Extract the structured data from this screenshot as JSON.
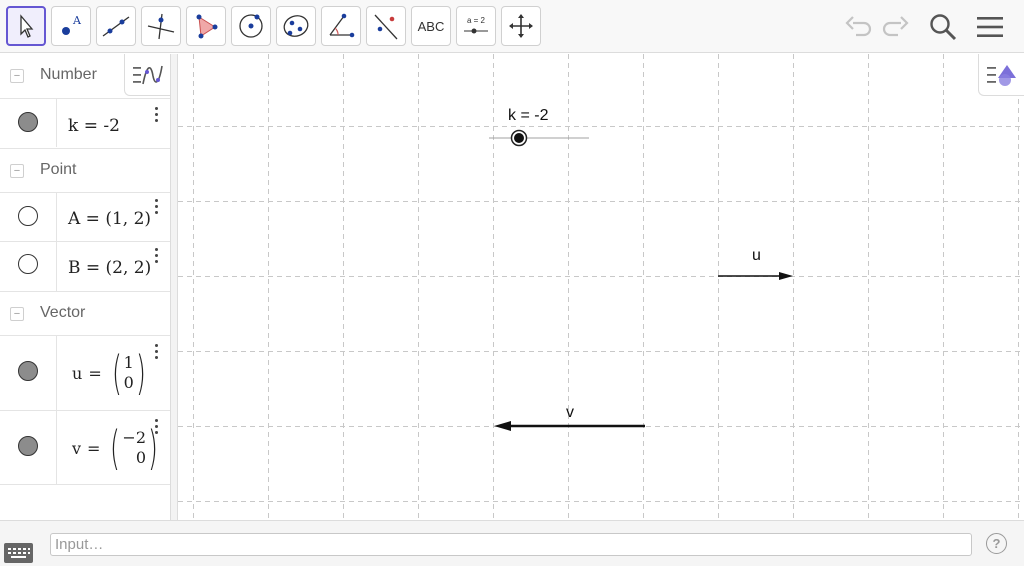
{
  "toolbar": {
    "tools": [
      {
        "name": "move-tool-icon"
      },
      {
        "name": "point-tool-icon"
      },
      {
        "name": "line-tool-icon"
      },
      {
        "name": "perpendicular-line-tool-icon"
      },
      {
        "name": "polygon-tool-icon"
      },
      {
        "name": "circle-center-point-tool-icon"
      },
      {
        "name": "ellipse-tool-icon"
      },
      {
        "name": "angle-tool-icon"
      },
      {
        "name": "reflect-tool-icon"
      },
      {
        "name": "text-tool-icon",
        "label": "ABC"
      },
      {
        "name": "slider-tool-icon",
        "label": "a = 2"
      },
      {
        "name": "move-graphics-view-tool-icon"
      }
    ],
    "right": [
      "undo-icon",
      "redo-icon",
      "search-icon",
      "menu-icon"
    ]
  },
  "algebra": {
    "groups": [
      {
        "label": "Number",
        "items": [
          {
            "def": "k = -2",
            "marble": "filled"
          }
        ]
      },
      {
        "label": "Point",
        "items": [
          {
            "def": "A = (1, 2)",
            "marble": "empty"
          },
          {
            "def": "B = (2, 2)",
            "marble": "empty"
          }
        ]
      },
      {
        "label": "Vector",
        "items": [
          {
            "name": "u",
            "eq": "=",
            "comp": [
              "1",
              "0"
            ],
            "marble": "filled"
          },
          {
            "name": "v",
            "eq": "=",
            "comp": [
              "−2",
              "0"
            ],
            "marble": "filled"
          }
        ]
      }
    ]
  },
  "graphics": {
    "slider_label": "k = -2",
    "vector_u_label": "u",
    "vector_v_label": "v",
    "grid": true
  },
  "inputbar": {
    "placeholder": "Input…",
    "help": "?"
  },
  "colors": {
    "accent": "#6557d2",
    "marble_fill": "#8c8c8c",
    "grid": "#c8c8c8"
  }
}
